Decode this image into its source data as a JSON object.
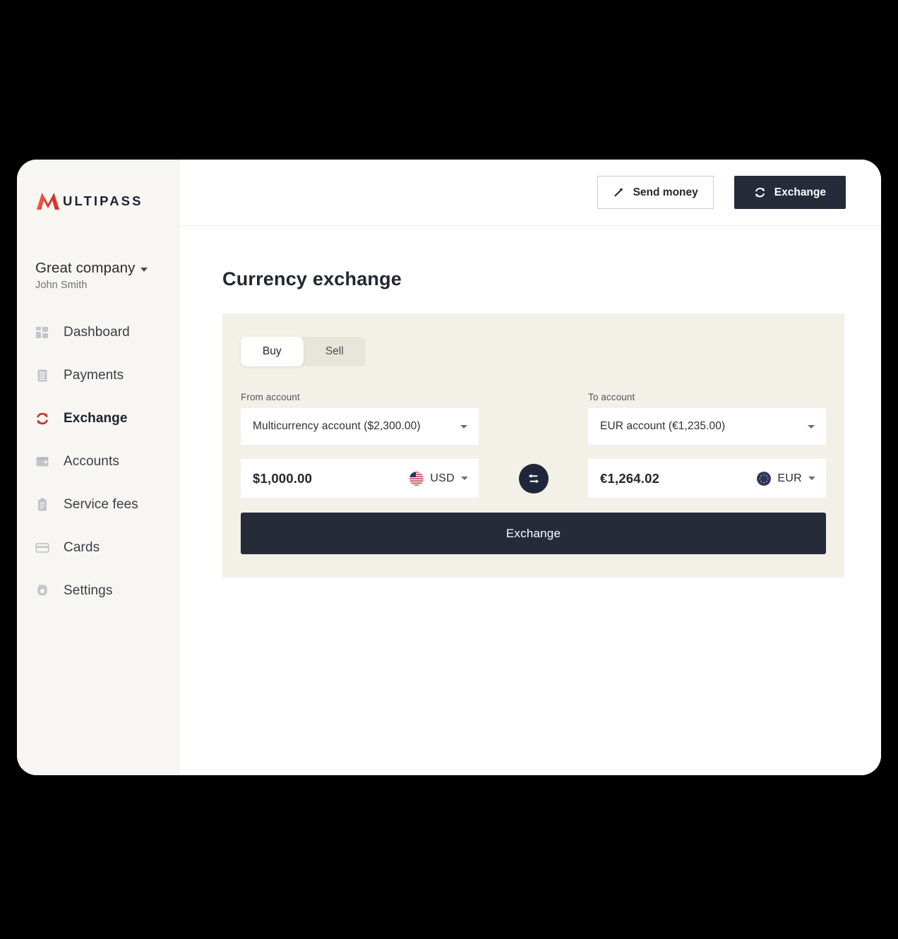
{
  "brand": {
    "logo_mark": "multipass-m-logo",
    "logo_text": "ULTIPASS",
    "accent_red": "#d8342a",
    "dark": "#262b3a",
    "panel_bg": "#f3f0e7",
    "sidebar_bg": "#f7f6f3"
  },
  "sidebar": {
    "company": "Great company",
    "user": "John Smith",
    "company_caret_icon": "chevron-down-icon",
    "items": [
      {
        "label": "Dashboard",
        "icon": "grid-icon",
        "active": false
      },
      {
        "label": "Payments",
        "icon": "list-icon",
        "active": false
      },
      {
        "label": "Exchange",
        "icon": "refresh-icon",
        "active": true
      },
      {
        "label": "Accounts",
        "icon": "wallet-icon",
        "active": false
      },
      {
        "label": "Service fees",
        "icon": "clipboard-icon",
        "active": false
      },
      {
        "label": "Cards",
        "icon": "card-icon",
        "active": false
      },
      {
        "label": "Settings",
        "icon": "gear-icon",
        "active": false
      }
    ]
  },
  "topbar": {
    "send_money_label": "Send money",
    "send_money_icon": "send-arrow-icon",
    "exchange_label": "Exchange",
    "exchange_icon": "refresh-icon"
  },
  "main": {
    "page_title": "Currency exchange"
  },
  "exchange": {
    "tabs": [
      {
        "label": "Buy",
        "active": true
      },
      {
        "label": "Sell",
        "active": false
      }
    ],
    "from": {
      "label": "From account",
      "account_value": "Multicurrency account ($2,300.00)",
      "amount_value": "$1,000.00",
      "currency_code": "USD",
      "flag_icon": "us-flag-icon",
      "caret_icon": "chevron-down-icon"
    },
    "to": {
      "label": "To account",
      "account_value": "EUR account (€1,235.00)",
      "amount_value": "€1,264.02",
      "currency_code": "EUR",
      "flag_icon": "eu-flag-icon",
      "caret_icon": "chevron-down-icon"
    },
    "swap_icon": "swap-horizontal-icon",
    "submit_label": "Exchange"
  }
}
